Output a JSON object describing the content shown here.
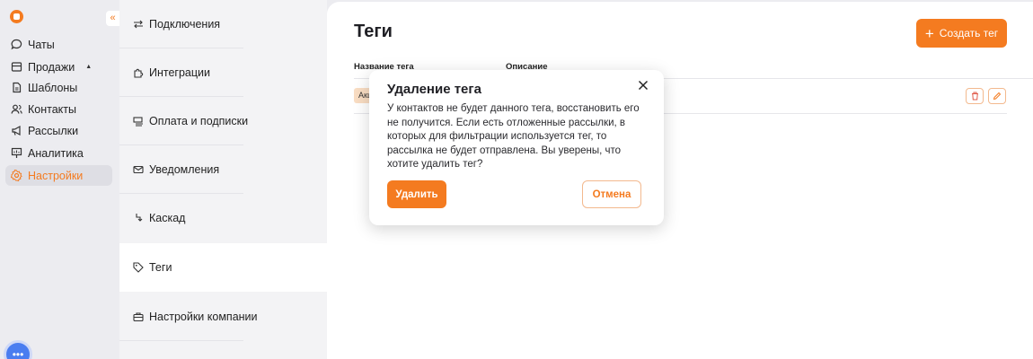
{
  "nav": {
    "items": [
      {
        "label": "Чаты",
        "icon": "chat-icon"
      },
      {
        "label": "Продажи",
        "icon": "store-icon"
      },
      {
        "label": "Шаблоны",
        "icon": "document-icon"
      },
      {
        "label": "Контакты",
        "icon": "users-icon"
      },
      {
        "label": "Рассылки",
        "icon": "megaphone-icon"
      },
      {
        "label": "Аналитика",
        "icon": "chart-board-icon"
      },
      {
        "label": "Настройки",
        "icon": "gear-icon",
        "active": true
      }
    ],
    "collapse_glyph": "«"
  },
  "settings": {
    "items": [
      {
        "label": "Подключения",
        "icon": "arrows-swap-icon"
      },
      {
        "label": "Интеграции",
        "icon": "puzzle-icon"
      },
      {
        "label": "Оплата и подписки",
        "icon": "money-icon"
      },
      {
        "label": "Уведомления",
        "icon": "mail-icon"
      },
      {
        "label": "Каскад",
        "icon": "cascade-icon"
      },
      {
        "label": "Теги",
        "icon": "tag-icon",
        "active": true
      },
      {
        "label": "Настройки компании",
        "icon": "briefcase-icon"
      }
    ]
  },
  "main": {
    "title": "Теги",
    "create_label": "Создать тег",
    "columns": [
      "Название тега",
      "Описание"
    ],
    "rows": [
      {
        "tag": "Акц"
      }
    ]
  },
  "modal": {
    "title": "Удаление тега",
    "text": "У контактов не будет данного тега, восстановить его не получится. Если есть отложенные рассылки, в которых для фильтрации используется тег, то рассылка не будет отправлена. Вы уверены, что хотите удалить тег?",
    "delete_label": "Удалить",
    "cancel_label": "Отмена"
  },
  "colors": {
    "accent": "#f47b20",
    "accent_border": "#f3b98e",
    "tag_chip": "#f9ddc3"
  }
}
